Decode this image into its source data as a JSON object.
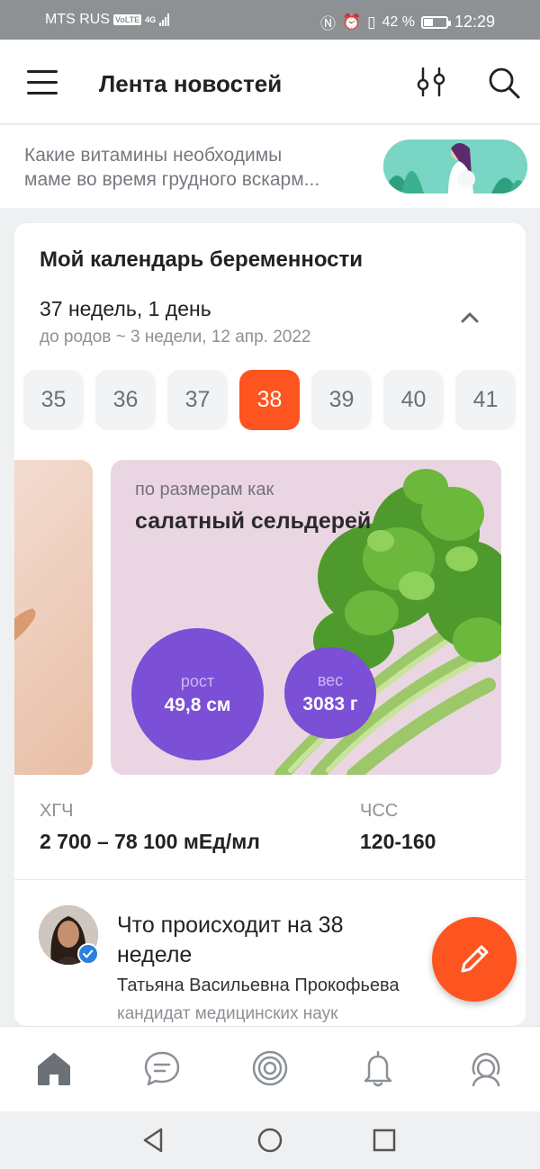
{
  "status_bar": {
    "carrier": "MTS RUS",
    "volte_badge": "VoLTE",
    "network": "4G",
    "battery_percent": "42 %",
    "battery_level": 0.42,
    "time": "12:29"
  },
  "header": {
    "title": "Лента новостей",
    "icons": [
      "menu-icon",
      "filter-icon",
      "search-icon"
    ]
  },
  "promo": {
    "line1": "Какие витамины необходимы",
    "line2": "маме во время грудного вскарм..."
  },
  "calendar": {
    "title": "Мой календарь беременности",
    "weeks": "37 недель, 1 день",
    "due": "до родов ~ 3 недели, 12 апр. 2022",
    "week_chips": [
      "35",
      "36",
      "37",
      "38",
      "39",
      "40",
      "41"
    ],
    "selected_week": "38",
    "size": {
      "label": "по размерам как",
      "value": "салатный сельдерей"
    },
    "height": {
      "label": "рост",
      "value": "49,8 см"
    },
    "weight": {
      "label": "вес",
      "value": "3083 г"
    },
    "hcg": {
      "label": "ХГЧ",
      "value": "2 700 – 78 100  мЕд/мл"
    },
    "hr": {
      "label": "ЧСС",
      "value": "120-160"
    }
  },
  "article": {
    "title": "Что происходит на 38 неделе",
    "author": "Татьяна Васильевна Прокофьева",
    "author_title": "кандидат медицинских наук"
  },
  "bottom_nav": {
    "items": [
      "home-icon",
      "chat-icon",
      "target-icon",
      "bell-icon",
      "profile-icon"
    ],
    "active": "home-icon"
  },
  "colors": {
    "accent": "#fd5420",
    "purple": "#7b4fd6",
    "slide_bg": "#ead6e2"
  }
}
